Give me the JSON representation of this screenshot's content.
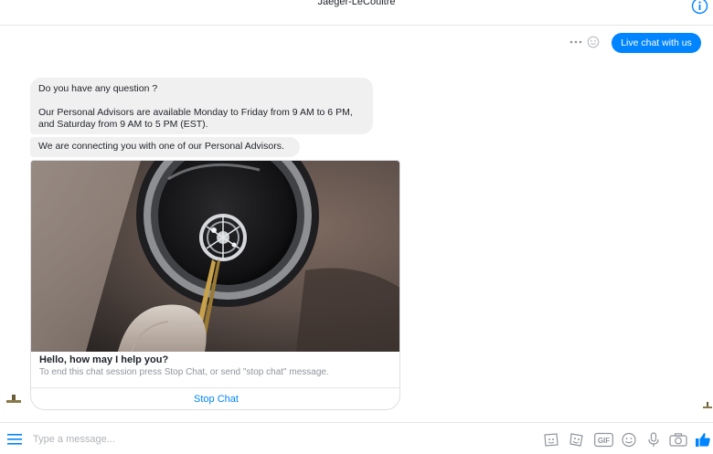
{
  "header": {
    "title": "Jaeger-LeCoultre",
    "info_icon": "info-icon"
  },
  "conversation": {
    "outgoing": {
      "button_label": "Live chat with us"
    },
    "incoming": {
      "bubble_1": {
        "line_1": "Do you have any question ?",
        "line_2": "Our Personal Advisors are available Monday to Friday from 9 AM to 6 PM,",
        "line_3": "and Saturday from 9 AM to 5 PM (EST)."
      },
      "bubble_2": "We are connecting you with one of our Personal Advisors.",
      "card": {
        "image": "watch-movement-held-by-tweezers-photo",
        "title": "Hello, how may I help you?",
        "subtitle": "To end this chat session press Stop Chat, or send \"stop chat\" message.",
        "button_label": "Stop Chat"
      }
    }
  },
  "composer": {
    "placeholder": "Type a message...",
    "tools": [
      "menu-icon",
      "stickers-icon",
      "photo-sticker-icon",
      "gif-icon",
      "emoji-icon",
      "microphone-icon",
      "camera-icon",
      "thumbs-up-icon"
    ],
    "gif_label": "GIF"
  },
  "colors": {
    "accent": "#0084ff",
    "bubble": "#f1f0f0",
    "divider": "#e5e5e5",
    "muted": "#90949c"
  }
}
